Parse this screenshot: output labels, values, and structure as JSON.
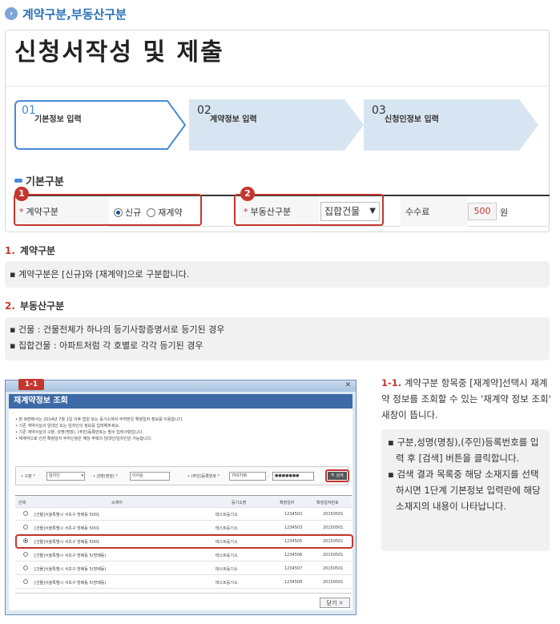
{
  "section": {
    "title": "계약구분,부동산구분"
  },
  "page_title": "신청서작성 및 제출",
  "steps": [
    {
      "num": "01",
      "label": "기본정보 입력"
    },
    {
      "num": "02",
      "label": "계약정보 입력"
    },
    {
      "num": "03",
      "label": "신청인정보 입력"
    }
  ],
  "basic": {
    "heading": "기본구분"
  },
  "form": {
    "contract_label": "계약구분",
    "radio_new": "신규",
    "radio_renew": "재계약",
    "property_label": "부동산구분",
    "property_value": "집합건물",
    "fee_label": "수수료",
    "fee_value": "500",
    "fee_unit": "원",
    "badge1": "1",
    "badge2": "2"
  },
  "items": [
    {
      "num": "1.",
      "title": "계약구분",
      "lines": [
        "▪ 계약구분은 [신규]와 [재계약]으로 구분합니다."
      ]
    },
    {
      "num": "2.",
      "title": "부동산구분",
      "lines": [
        "▪ 건물 : 건물전체가 하나의 등기사항증명서로 등기된 경우",
        "▪ 집합건물 : 아파트처럼 각 호별로 각각 등기된 경우"
      ]
    }
  ],
  "popup": {
    "badge": "1-1",
    "title": "재계약정보 조회",
    "notes": [
      "• 본 화면에서는 2014년 7월 1일 이후 법원 또는 등기소에서 부여받은 확정일자 정보를 이용합니다.",
      "• 기존 계약사실의 임대인 또는 임차인의 정보를 입력해주세요.",
      "• 기존 계약사실의 구분, 성명(명칭), (주민)등록번호는 필수 입력사항입니다.",
      "• 재계약으로 인한 확정일자 부여신청은 해당 주택의 임대인/임차인만 가능합니다."
    ],
    "search": {
      "type_label": "구분",
      "type_value": "임차인",
      "name_label": "성명(명칭)",
      "name_value": "이이순",
      "reg_label": "(주민)등록번호",
      "reg_front": "700708",
      "reg_back": "●●●●●●●",
      "search_btn": "검색"
    },
    "columns": [
      "선택",
      "소재지",
      "등기소명",
      "확정일자",
      "확정일자번호"
    ],
    "rows": [
      {
        "addr": "[건물]서울특별시 서초구 방배동 5001",
        "office": "테스트등기소",
        "date": "1234502",
        "no": "20150501",
        "selected": false
      },
      {
        "addr": "[건물]서울특별시 서초구 방배동 5001",
        "office": "테스트등기소",
        "date": "1234503",
        "no": "20150501",
        "selected": false
      },
      {
        "addr": "[건물]서울특별시 서초구 방배동 5001",
        "office": "테스트등기소",
        "date": "1234505",
        "no": "20150501",
        "selected": true
      },
      {
        "addr": "[건물]서울특별시 서초구 방배동 5(방배동)",
        "office": "테스트등기소",
        "date": "1234506",
        "no": "20150501",
        "selected": false
      },
      {
        "addr": "[건물]서울특별시 서초구 방배동 5(방배동)",
        "office": "테스트등기소",
        "date": "1234507",
        "no": "20150501",
        "selected": false
      },
      {
        "addr": "[건물]서울특별시 서초구 방배동 5(방배동)",
        "office": "테스트등기소",
        "date": "1234508",
        "no": "20150501",
        "selected": false
      }
    ],
    "close_btn": "닫기"
  },
  "side": {
    "intro_num": "1-1.",
    "intro": "계약구분 항목중 [재계약]선택시 재계약 정보를 조회할 수 있는 '재계약 정보 조회' 새창이 뜹니다.",
    "bullets": [
      "구분,성명(명칭),(주민)등록번호를 입력 후 [검색] 버튼을 클릭합니다.",
      "검색 결과 목록중 해당 소재지를 선택하시면 1단계 기본정보 입력란에 해당 소재지의 내용이 나타납니다."
    ]
  }
}
